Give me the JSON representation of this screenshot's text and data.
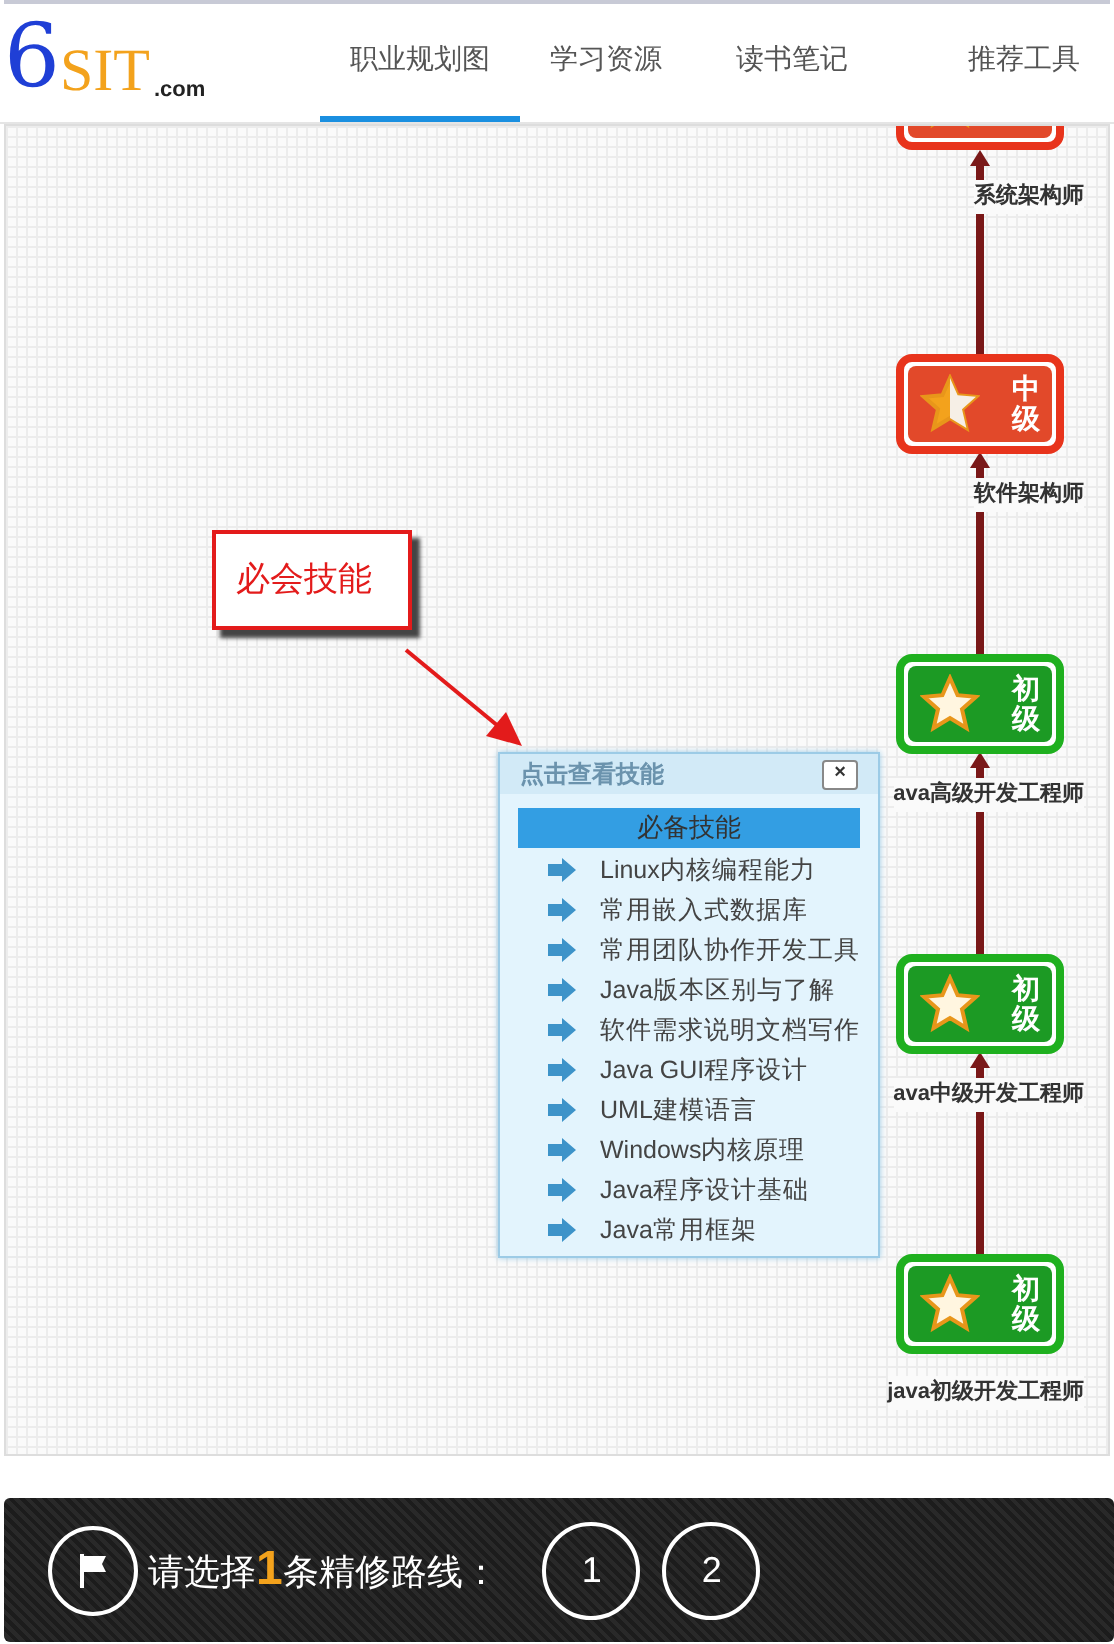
{
  "logo": {
    "mark": "6",
    "name": "SIT",
    "suffix": ".com"
  },
  "tabs": [
    {
      "label": "职业规划图",
      "selected": true
    },
    {
      "label": "学习资源",
      "selected": false
    },
    {
      "label": "读书笔记",
      "selected": false
    },
    {
      "label": "推荐工具",
      "selected": false
    }
  ],
  "nodes": [
    {
      "kind": "mid",
      "label": "系统架构师"
    },
    {
      "kind": "mid",
      "grade": "中级",
      "label": "软件架构师"
    },
    {
      "kind": "junior",
      "grade": "初级",
      "label": "ava高级开发工程师"
    },
    {
      "kind": "junior",
      "grade": "初级",
      "label": "ava中级开发工程师"
    },
    {
      "kind": "junior",
      "grade": "初级",
      "label": "java初级开发工程师"
    }
  ],
  "callout": "必会技能",
  "popup": {
    "title": "点击查看技能",
    "close": "×",
    "heading": "必备技能",
    "items": [
      "Linux内核编程能力",
      "常用嵌入式数据库",
      "常用团队协作开发工具",
      "Java版本区别与了解",
      "软件需求说明文档写作",
      "Java GUI程序设计",
      "UML建模语言",
      "Windows内核原理",
      "Java程序设计基础",
      "Java常用框架"
    ]
  },
  "footer": {
    "prompt_before": "请选择",
    "count": "1",
    "prompt_after": "条精修路线：",
    "routes": [
      "1",
      "2"
    ]
  }
}
